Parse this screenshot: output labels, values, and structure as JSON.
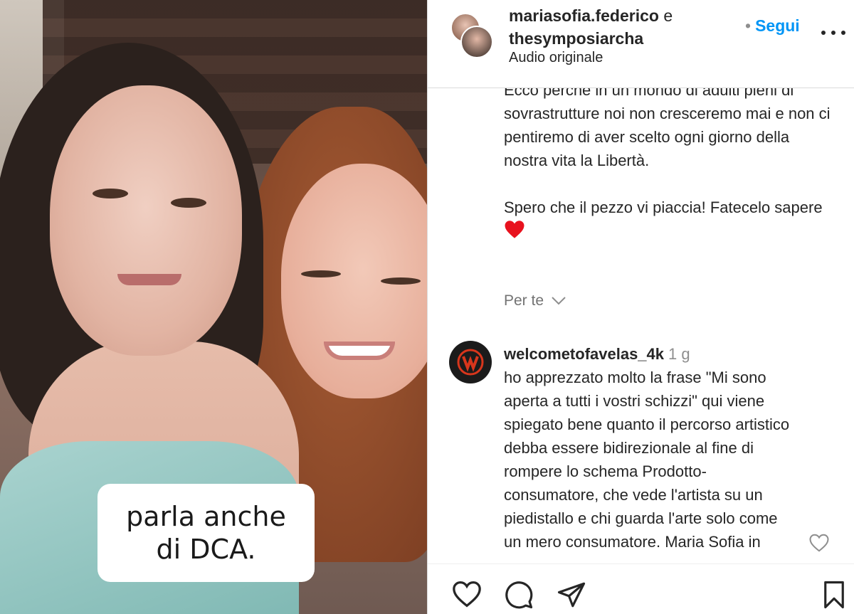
{
  "media": {
    "caption_line1": "parla anche",
    "caption_line2": "di DCA."
  },
  "header": {
    "user1": "mariasofia.federico",
    "conjunction": "e",
    "user2": "thesymposiarcha",
    "audio": "Audio originale",
    "follow_dot": "•",
    "follow_label": "Segui"
  },
  "description": {
    "paragraph1": "Ecco perché in un mondo di adulti pieni di sovrastrutture noi non cresceremo mai e non ci pentiremo di aver scelto ogni giorno della nostra vita la Libertà.",
    "paragraph2": "Spero che il pezzo vi piaccia! Fatecelo sapere"
  },
  "per_te": {
    "label": "Per te"
  },
  "comment": {
    "username": "welcometofavelas_4k",
    "time": "1 g",
    "text": "ho apprezzato molto la frase \"Mi sono aperta a tutti i vostri schizzi\" qui viene spiegato bene quanto il percorso artistico debba essere bidirezionale al fine di rompere lo schema Prodotto-consumatore, che vede l'artista su un piedistallo e chi guarda l'arte solo come un mero consumatore. Maria Sofia in"
  },
  "colors": {
    "accent": "#0095f6",
    "text": "#262626",
    "muted": "#737373",
    "heart": "#e8121e"
  },
  "icons": [
    "heart-icon",
    "comment-icon",
    "share-icon",
    "bookmark-icon",
    "chevron-down-icon",
    "more-icon",
    "comment-like-icon"
  ]
}
